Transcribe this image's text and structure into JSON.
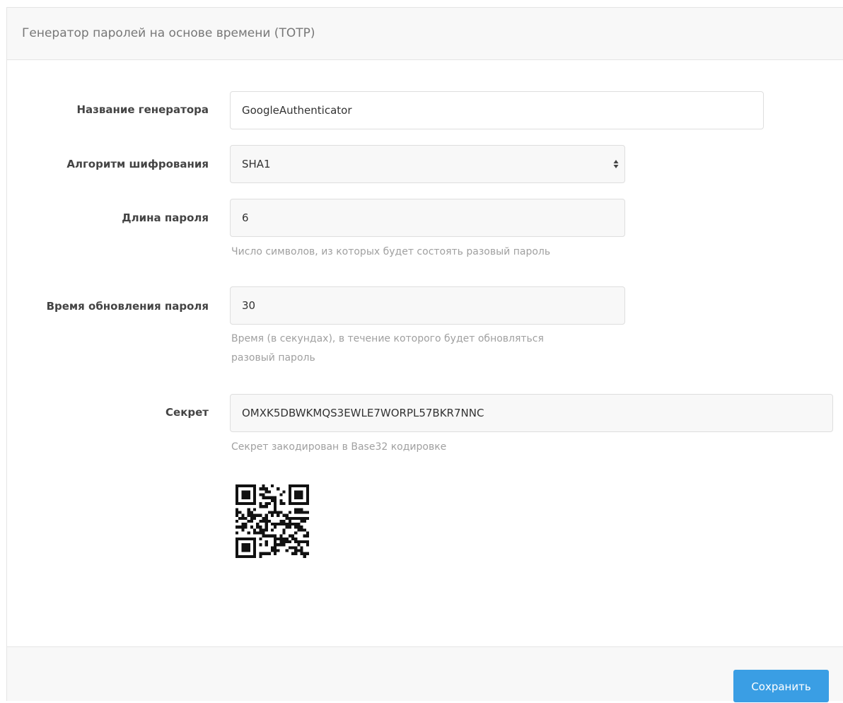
{
  "panel": {
    "title": "Генератор паролей на основе времени (TOTP)"
  },
  "form": {
    "generator_name": {
      "label": "Название генератора",
      "value": "GoogleAuthenticator"
    },
    "algorithm": {
      "label": "Алгоритм шифрования",
      "selected": "SHA1"
    },
    "password_length": {
      "label": "Длина пароля",
      "value": "6",
      "help": "Число символов, из которых будет состоять разовый пароль"
    },
    "refresh_time": {
      "label": "Время обновления пароля",
      "value": "30",
      "help_line1": "Время (в секундах), в течение которого будет обновляться",
      "help_line2": "разовый пароль"
    },
    "secret": {
      "label": "Секрет",
      "value": "OMXK5DBWKMQS3EWLE7WORPL57BKR7NNC",
      "help": "Секрет закодирован в Base32 кодировке"
    }
  },
  "footer": {
    "save_label": "Сохранить"
  },
  "colors": {
    "primary_button": "#3a9ee4",
    "panel_header_bg": "#f8f8f8",
    "help_text": "#a0a0a0"
  },
  "icons": {
    "select_arrows": "sort-arrows-icon",
    "qr": "qr-code"
  }
}
